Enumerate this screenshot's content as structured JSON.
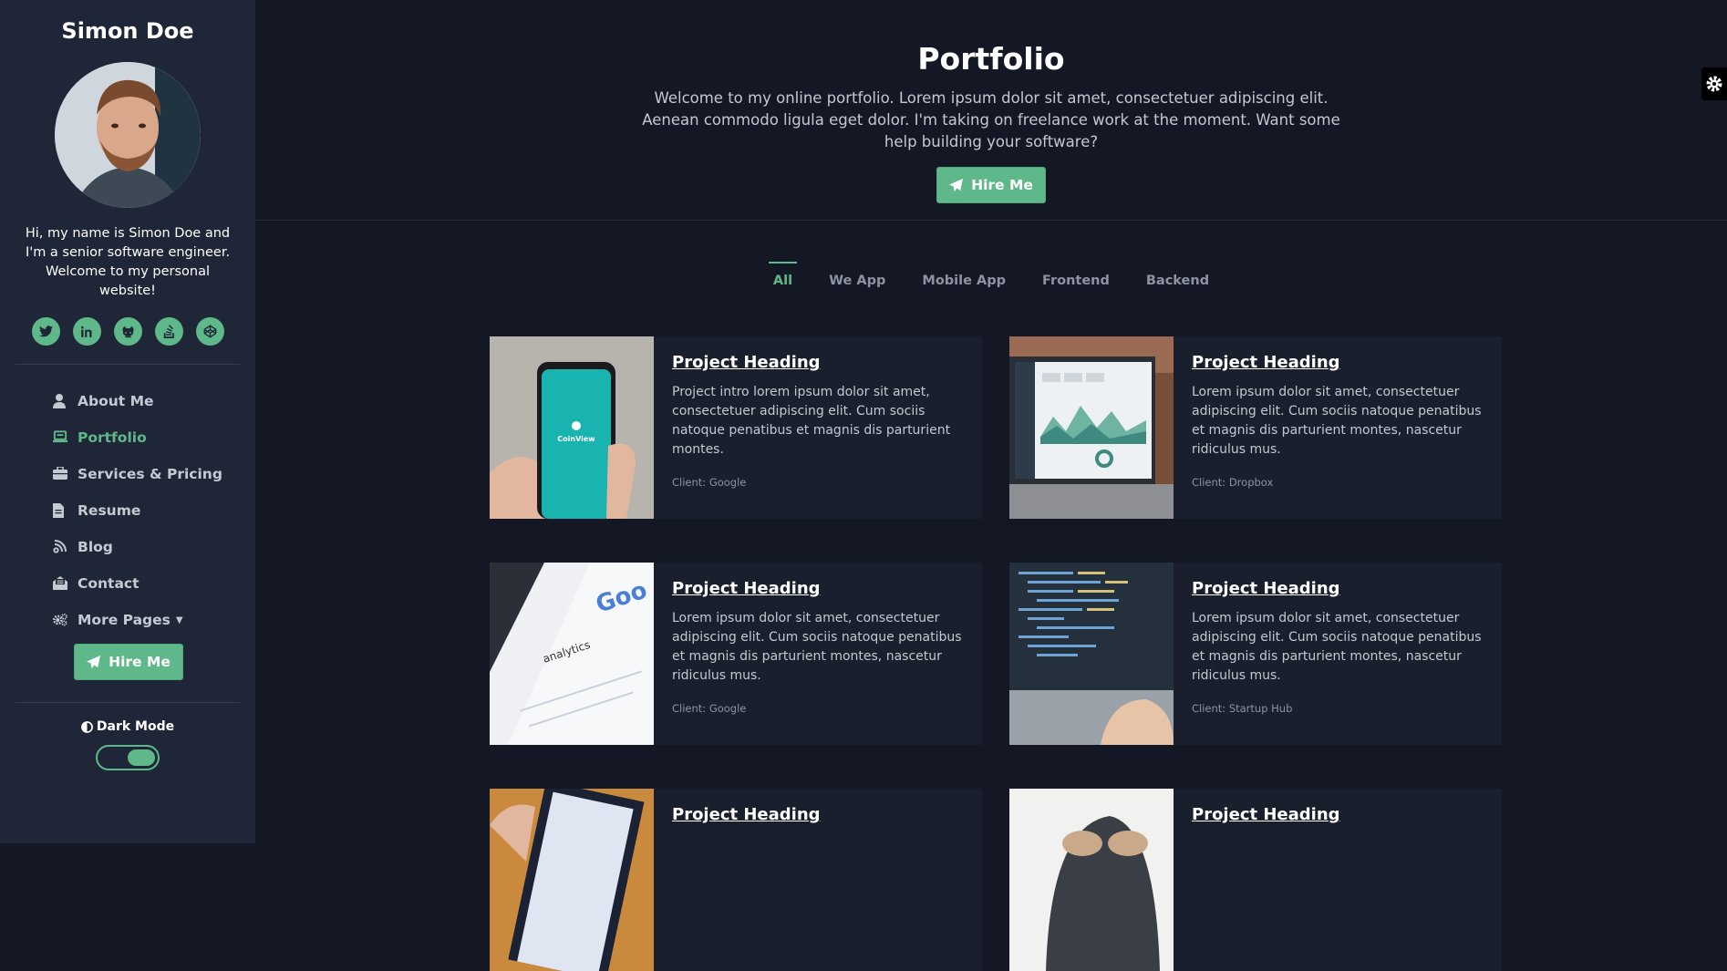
{
  "sidebar": {
    "name": "Simon Doe",
    "bio": "Hi, my name is Simon Doe and I'm a senior software engineer. Welcome to my personal website!",
    "socials": [
      "twitter-icon",
      "linkedin-icon",
      "github-icon",
      "stack-overflow-icon",
      "codepen-icon"
    ],
    "nav": [
      {
        "label": "About Me",
        "icon": "user-icon"
      },
      {
        "label": "Portfolio",
        "icon": "laptop-icon",
        "active": true
      },
      {
        "label": "Services & Pricing",
        "icon": "briefcase-icon"
      },
      {
        "label": "Resume",
        "icon": "file-icon"
      },
      {
        "label": "Blog",
        "icon": "blog-icon"
      },
      {
        "label": "Contact",
        "icon": "envelope-open-icon"
      },
      {
        "label": "More Pages",
        "icon": "cogs-icon"
      }
    ],
    "hire_label": "Hire Me",
    "dark_mode_label": "Dark Mode",
    "dark_mode_on": true
  },
  "hero": {
    "title": "Portfolio",
    "intro": "Welcome to my online portfolio. Lorem ipsum dolor sit amet, consectetuer adipiscing elit. Aenean commodo ligula eget dolor. I'm taking on freelance work at the moment. Want some help building your software?",
    "hire_label": "Hire Me"
  },
  "filters": [
    "All",
    "We App",
    "Mobile App",
    "Frontend",
    "Backend"
  ],
  "active_filter": "All",
  "projects": [
    {
      "heading": "Project Heading",
      "intro": "Project intro lorem ipsum dolor sit amet, consectetuer adipiscing elit. Cum sociis natoque penatibus et magnis dis parturient montes.",
      "client": "Client: Google",
      "thumb_text": "CoinView"
    },
    {
      "heading": "Project Heading",
      "intro": "Lorem ipsum dolor sit amet, consectetuer adipiscing elit. Cum sociis natoque penatibus et magnis dis parturient montes, nascetur ridiculus mus.",
      "client": "Client: Dropbox"
    },
    {
      "heading": "Project Heading",
      "intro": "Lorem ipsum dolor sit amet, consectetuer adipiscing elit. Cum sociis natoque penatibus et magnis dis parturient montes, nascetur ridiculus mus.",
      "client": "Client: Google",
      "thumb_text": "analytics"
    },
    {
      "heading": "Project Heading",
      "intro": "Lorem ipsum dolor sit amet, consectetuer adipiscing elit. Cum sociis natoque penatibus et magnis dis parturient montes, nascetur ridiculus mus.",
      "client": "Client: Startup Hub"
    },
    {
      "heading": "Project Heading"
    },
    {
      "heading": "Project Heading"
    }
  ],
  "colors": {
    "accent": "#5fb889",
    "sidebar": "#1f2637",
    "background": "#141824"
  }
}
